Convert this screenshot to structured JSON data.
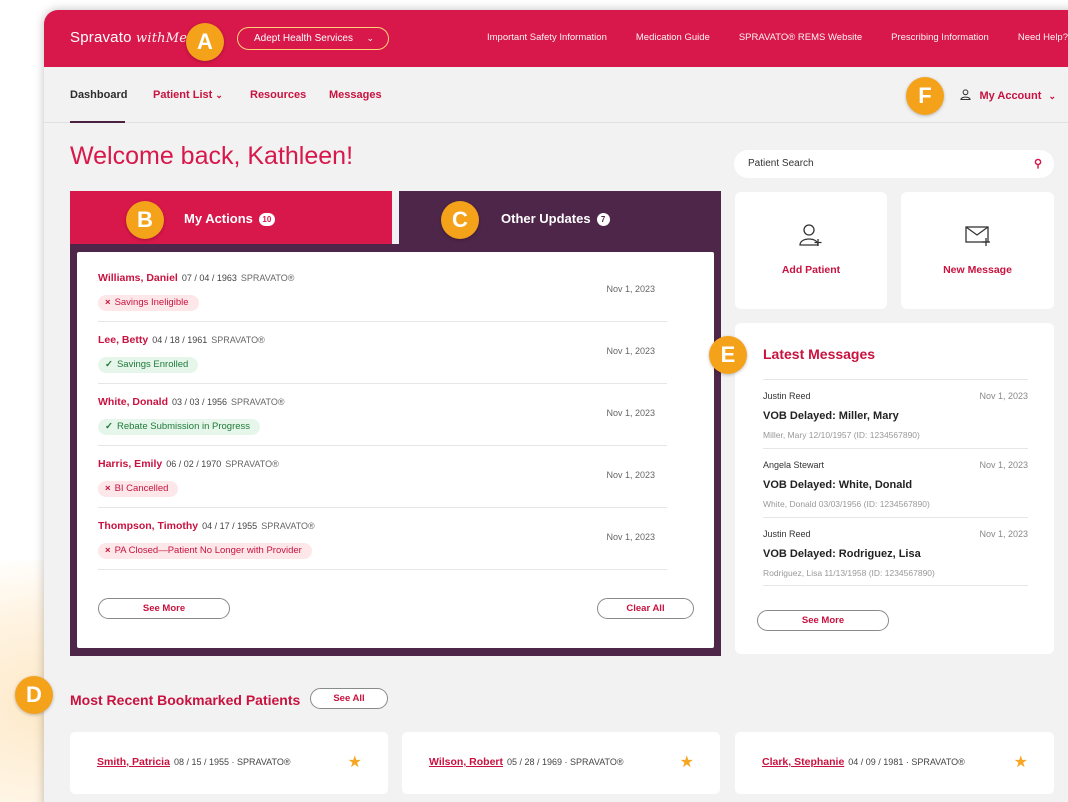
{
  "header": {
    "logo": "Spravato",
    "logo_suffix": "withMe",
    "org_select": "Adept Health Services",
    "links": [
      "Important Safety Information",
      "Medication Guide",
      "SPRAVATO® REMS Website",
      "Prescribing Information",
      "Need Help?"
    ]
  },
  "nav": {
    "items": [
      "Dashboard",
      "Patient List",
      "Resources",
      "Messages"
    ],
    "account": "My Account"
  },
  "welcome": "Welcome back, Kathleen!",
  "search": {
    "placeholder": "Patient Search"
  },
  "tabs": {
    "actions": {
      "label": "My Actions",
      "count": "10"
    },
    "updates": {
      "label": "Other Updates",
      "count": "7"
    }
  },
  "actions": [
    {
      "name": "Williams, Daniel",
      "dob": "07 / 04 / 1963",
      "drug": "SPRAVATO®",
      "date": "Nov 1, 2023",
      "status": "Savings Ineligible",
      "kind": "neg"
    },
    {
      "name": "Lee, Betty",
      "dob": "04 / 18 / 1961",
      "drug": "SPRAVATO®",
      "date": "Nov 1, 2023",
      "status": "Savings Enrolled",
      "kind": "pos"
    },
    {
      "name": "White, Donald",
      "dob": "03 / 03 / 1956",
      "drug": "SPRAVATO®",
      "date": "Nov 1, 2023",
      "status": "Rebate Submission in Progress",
      "kind": "pos"
    },
    {
      "name": "Harris, Emily",
      "dob": "06 / 02 / 1970",
      "drug": "SPRAVATO®",
      "date": "Nov 1, 2023",
      "status": "BI Cancelled",
      "kind": "neg"
    },
    {
      "name": "Thompson, Timothy",
      "dob": "04 / 17 / 1955",
      "drug": "SPRAVATO®",
      "date": "Nov 1, 2023",
      "status": "PA Closed—Patient No Longer with Provider",
      "kind": "neg"
    }
  ],
  "actions_buttons": {
    "see_more": "See More",
    "clear_all": "Clear All"
  },
  "quick": {
    "add_patient": "Add Patient",
    "new_message": "New Message"
  },
  "messages": {
    "title": "Latest Messages",
    "items": [
      {
        "from": "Justin Reed",
        "date": "Nov 1, 2023",
        "subject": "VOB Delayed: Miller, Mary",
        "ref": "Miller, Mary  12/10/1957  (ID: 1234567890)"
      },
      {
        "from": "Angela Stewart",
        "date": "Nov 1, 2023",
        "subject": "VOB Delayed: White, Donald",
        "ref": "White, Donald  03/03/1956  (ID: 1234567890)"
      },
      {
        "from": "Justin Reed",
        "date": "Nov 1, 2023",
        "subject": "VOB Delayed: Rodriguez, Lisa",
        "ref": "Rodriguez, Lisa  11/13/1958  (ID: 1234567890)"
      }
    ],
    "see_more": "See More"
  },
  "bookmarks": {
    "title": "Most Recent Bookmarked Patients",
    "see_all": "See All",
    "items": [
      {
        "name": "Smith, Patricia",
        "meta": "08 / 15 / 1955  ·  SPRAVATO®"
      },
      {
        "name": "Wilson, Robert",
        "meta": "05 / 28 / 1969  ·  SPRAVATO®"
      },
      {
        "name": "Clark, Stephanie",
        "meta": "04 / 09 / 1981  ·  SPRAVATO®"
      }
    ]
  },
  "markers": [
    "A",
    "B",
    "C",
    "D",
    "E",
    "F"
  ],
  "colors": {
    "brand": "#d8174a",
    "plum": "#4e2649",
    "marker": "#f5a21b",
    "positive": "#1f7a3a"
  }
}
